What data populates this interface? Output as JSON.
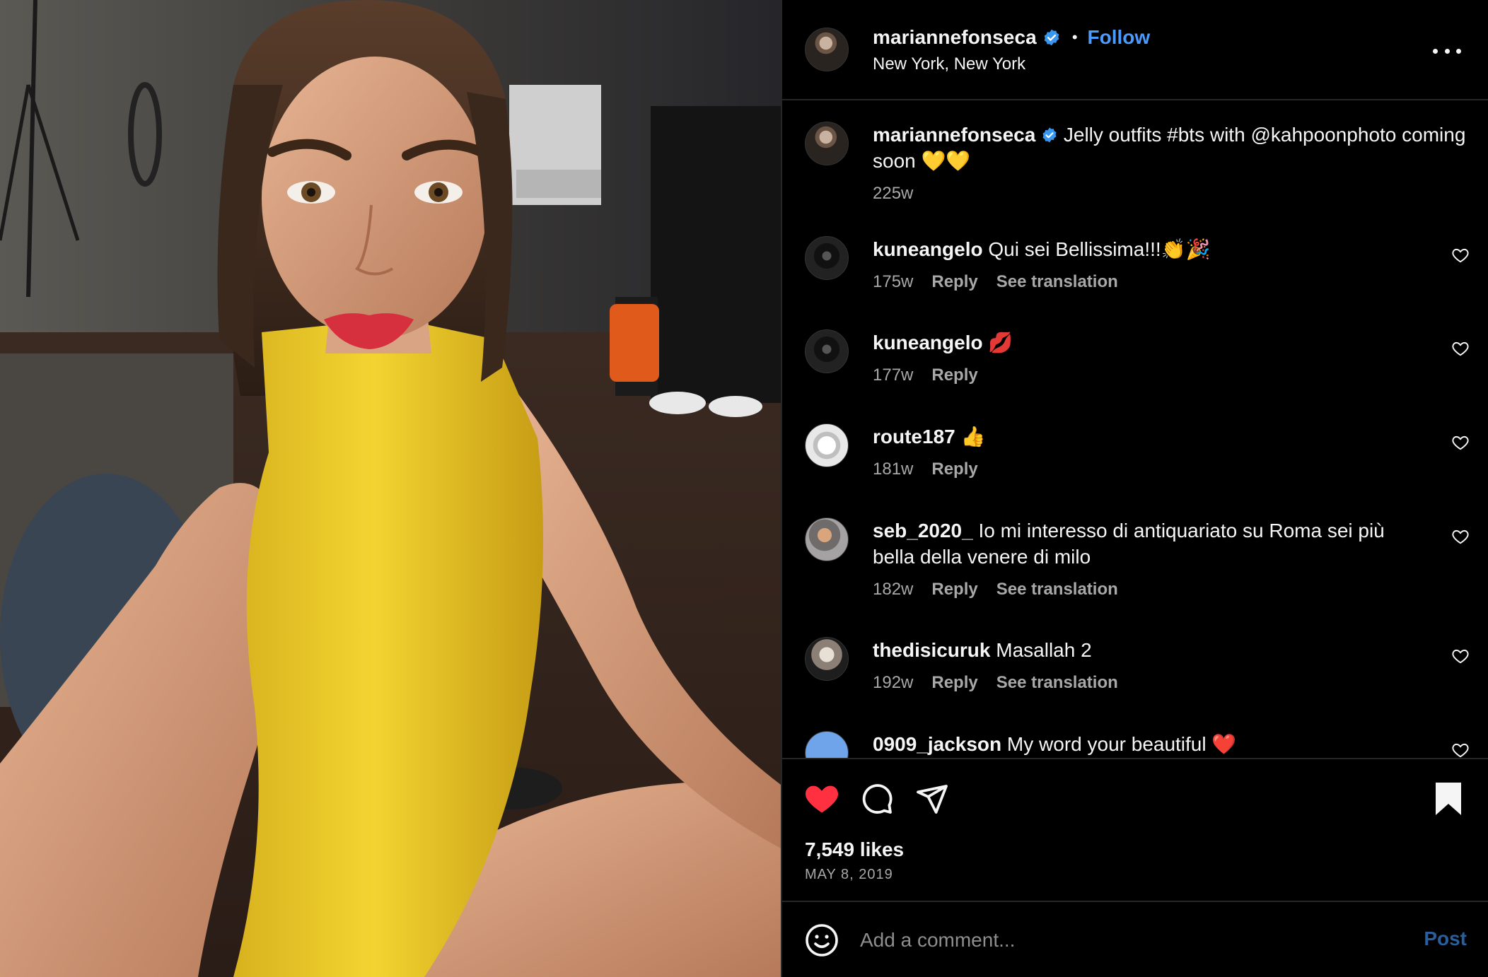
{
  "post": {
    "author": "mariannefonseca",
    "verified": true,
    "follow_label": "Follow",
    "separator": "•",
    "location": "New York, New York",
    "more_icon": "more-horizontal-icon"
  },
  "caption": {
    "username": "mariannefonseca",
    "text": "Jelly outfits #bts with @kahpoonphoto coming soon 💛💛",
    "age": "225w"
  },
  "comments": [
    {
      "username": "kuneangelo",
      "text": "Qui sei Bellissima!!!👏🎉",
      "age": "175w",
      "reply": "Reply",
      "translate": "See translation"
    },
    {
      "username": "kuneangelo",
      "text": "💋",
      "age": "177w",
      "reply": "Reply",
      "translate": ""
    },
    {
      "username": "route187",
      "text": "👍",
      "age": "181w",
      "reply": "Reply",
      "translate": ""
    },
    {
      "username": "seb_2020_",
      "text": "Io mi interesso di antiquariato su Roma sei più bella della venere di milo",
      "age": "182w",
      "reply": "Reply",
      "translate": "See translation"
    },
    {
      "username": "thedisicuruk",
      "text": "Masallah 2",
      "age": "192w",
      "reply": "Reply",
      "translate": "See translation"
    },
    {
      "username": "0909_jackson",
      "text": "My word your beautiful ❤️",
      "age": "",
      "reply": "",
      "translate": ""
    }
  ],
  "actions": {
    "liked": true,
    "saved": true,
    "likes": "7,549 likes",
    "date": "MAY 8, 2019"
  },
  "add_comment": {
    "placeholder": "Add a comment...",
    "post_label": "Post"
  },
  "colors": {
    "background": "#000000",
    "link_blue": "#4b9bff",
    "like_red": "#ff3040",
    "muted": "#a8a8a8",
    "post_disabled": "#2a5f9e"
  }
}
